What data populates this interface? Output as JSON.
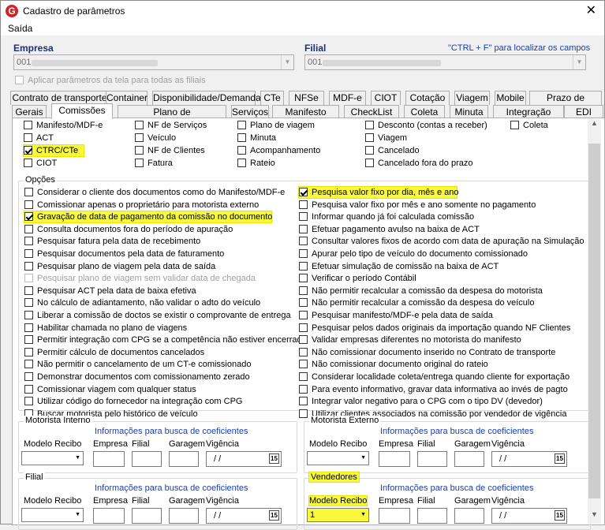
{
  "window": {
    "title": "Cadastro de parâmetros",
    "logo_letter": "G",
    "close_glyph": "✕"
  },
  "menu": {
    "exit": "Saída"
  },
  "header": {
    "empresa_label": "Empresa",
    "empresa_value": "001",
    "filial_label": "Filial",
    "filial_value": "001",
    "hint": "\"CTRL + F\" para localizar os campos",
    "apply_all": "Aplicar parâmetros da tela para todas as filiais"
  },
  "tabs_row1": [
    "Contrato de transporte",
    "Container",
    "Disponibilidade/Demanda",
    "CTe",
    "NFSe",
    "MDF-e",
    "CIOT",
    "Cotação",
    "Viagem",
    "Mobile",
    "Prazo de entrega"
  ],
  "tabs_row2": [
    "Gerais",
    "Comissões",
    "Plano de viagem/Despesas",
    "Serviços",
    "Manifesto",
    "CheckList",
    "Coleta",
    "Minuta",
    "Integração",
    "EDI"
  ],
  "doc_checks": {
    "col1": [
      {
        "label": "Manifesto/MDF-e",
        "checked": false
      },
      {
        "label": "ACT",
        "checked": false
      },
      {
        "label": "CTRC/CTe",
        "checked": true
      },
      {
        "label": "CIOT",
        "checked": false
      }
    ],
    "col2": [
      {
        "label": "NF de Serviços",
        "checked": false
      },
      {
        "label": "Veículo",
        "checked": false
      },
      {
        "label": "NF de Clientes",
        "checked": false
      },
      {
        "label": "Fatura",
        "checked": false
      }
    ],
    "col3": [
      {
        "label": "Plano de viagem",
        "checked": false
      },
      {
        "label": "Minuta",
        "checked": false
      },
      {
        "label": "Acompanhamento",
        "checked": false
      },
      {
        "label": "Rateio",
        "checked": false
      }
    ],
    "col4": [
      {
        "label": "Desconto (contas a receber)",
        "checked": false
      },
      {
        "label": "Viagem",
        "checked": false
      },
      {
        "label": "Cancelado",
        "checked": false
      },
      {
        "label": "Cancelado fora do prazo",
        "checked": false
      }
    ],
    "col5": [
      {
        "label": "Coleta",
        "checked": false
      }
    ]
  },
  "options": {
    "title": "Opções",
    "left": [
      {
        "label": "Considerar o cliente dos documentos como do Manifesto/MDF-e",
        "checked": false
      },
      {
        "label": "Comissionar apenas o proprietário para motorista externo",
        "checked": false
      },
      {
        "label": "Gravação de data de pagamento da comissão no documento",
        "checked": true
      },
      {
        "label": "Consulta documentos fora do período de apuração",
        "checked": false
      },
      {
        "label": "Pesquisar fatura pela data de recebimento",
        "checked": false
      },
      {
        "label": "Pesquisar documentos pela data de faturamento",
        "checked": false
      },
      {
        "label": "Pesquisar plano de viagem pela data de saída",
        "checked": false
      },
      {
        "label": "Pesquisar plano de viagem sem validar data de chegada",
        "checked": false,
        "disabled": true
      },
      {
        "label": "Pesquisar ACT pela data de baixa efetiva",
        "checked": false
      },
      {
        "label": "No cálculo de adiantamento, não validar o adto do veículo",
        "checked": false
      },
      {
        "label": "Liberar a comissão de doctos se existir o comprovante de entrega",
        "checked": false
      },
      {
        "label": "Habilitar chamada no plano de viagens",
        "checked": false
      },
      {
        "label": "Permitir integração com CPG se a competência não estiver encerrada",
        "checked": false
      },
      {
        "label": "Permitir cálculo de documentos cancelados",
        "checked": false
      },
      {
        "label": "Não permitir o cancelamento de um CT-e comissionado",
        "checked": false
      },
      {
        "label": "Demonstrar documentos com comissionamento zerado",
        "checked": false
      },
      {
        "label": "Comissionar viagem com qualquer status",
        "checked": false
      },
      {
        "label": "Utilizar código do fornecedor na integração com CPG",
        "checked": false
      },
      {
        "label": "Buscar motorista pelo histórico de veículo",
        "checked": false
      }
    ],
    "right": [
      {
        "label": "Pesquisa valor fixo por dia, mês e ano",
        "checked": true
      },
      {
        "label": "Pesquisa valor fixo por mês e ano somente no pagamento",
        "checked": false
      },
      {
        "label": "Informar quando já foi calculada comissão",
        "checked": false
      },
      {
        "label": "Efetuar pagamento avulso na baixa de ACT",
        "checked": false
      },
      {
        "label": "Consultar valores fixos de acordo com data de apuração na Simulação",
        "checked": false
      },
      {
        "label": "Apurar pelo tipo de veículo do documento comissionado",
        "checked": false
      },
      {
        "label": "Efetuar simulação de comissão na baixa de ACT",
        "checked": false
      },
      {
        "label": "Verificar o período Contábil",
        "checked": false
      },
      {
        "label": "Não permitir recalcular a comissão da despesa do motorista",
        "checked": false
      },
      {
        "label": "Não permitir recalcular a comissão da despesa do veículo",
        "checked": false
      },
      {
        "label": "Pesquisar manifesto/MDF-e pela data de saída",
        "checked": false
      },
      {
        "label": "Pesquisar pelos dados originais da importação quando NF Clientes",
        "checked": false
      },
      {
        "label": "Validar empresas diferentes no motorista do manifesto",
        "checked": false
      },
      {
        "label": "Não comissionar documento inserido no Contrato de transporte",
        "checked": false
      },
      {
        "label": "Não comissionar documento original do rateio",
        "checked": false
      },
      {
        "label": "Considerar localidade coleta/entrega quando cliente for exportação",
        "checked": false
      },
      {
        "label": "Para evento informativo, gravar data informativa ao invés de pagto",
        "checked": false
      },
      {
        "label": "Integrar valor negativo para o CPG com o tipo DV (devedor)",
        "checked": false
      },
      {
        "label": "Utilizar clientes associados na comissão por vendedor de vigência",
        "checked": false
      }
    ]
  },
  "coef_groups": {
    "info": "Informações para busca de coeficientes",
    "modelo": "Modelo Recibo",
    "empresa": "Empresa",
    "filial": "Filial",
    "garagem": "Garagem",
    "vigencia": "Vigência",
    "date_placeholder": "/ /",
    "cal_label": "15",
    "motorista_interno": "Motorista Interno",
    "motorista_externo": "Motorista Externo",
    "filial_group": "Filial",
    "vendedores": "Vendedores",
    "vendedores_modelo_value": "1"
  }
}
